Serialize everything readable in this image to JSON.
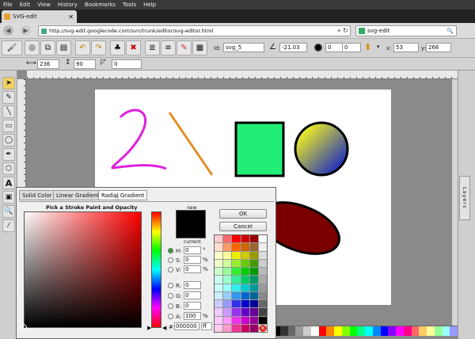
{
  "menubar": {
    "items": [
      "File",
      "Edit",
      "View",
      "History",
      "Bookmarks",
      "Tools",
      "Help"
    ]
  },
  "browser": {
    "tab_title": "SVG-edit",
    "url": "http://svg-edit.googlecode.com/svn/trunk/editor/svg-editor.html",
    "search_engine": "svg-edit"
  },
  "toolbar": {
    "id_label": "id:",
    "id_value": "svg_5",
    "angle_value": "-21.03",
    "stroke_width_value": "0",
    "blur_value": "0",
    "x_label": "x:",
    "x_value": "53",
    "y_label": "y:",
    "y_value": "266",
    "width_value": "236",
    "height_value": "90",
    "skew_value": "0"
  },
  "layers_label": "Layers",
  "dialog": {
    "tabs": [
      "Solid Color",
      "Linear Gradient",
      "Radial Gradient"
    ],
    "active_tab": 2,
    "heading": "Pick a Stroke Paint and Opacity",
    "new_label": "new",
    "current_label": "current",
    "ok_label": "OK",
    "cancel_label": "Cancel",
    "fields": [
      {
        "label": "H:",
        "value": "0",
        "unit": "°"
      },
      {
        "label": "S:",
        "value": "0",
        "unit": "%"
      },
      {
        "label": "V:",
        "value": "0",
        "unit": "%"
      },
      {
        "label": "R:",
        "value": "0",
        "unit": ""
      },
      {
        "label": "G:",
        "value": "0",
        "unit": ""
      },
      {
        "label": "B:",
        "value": "0",
        "unit": ""
      },
      {
        "label": "A:",
        "value": "100",
        "unit": "%"
      }
    ],
    "hex_label": "#:",
    "hex_value": "000000",
    "hex_alpha": "ff",
    "new_color": "#000000",
    "current_color": "#000000"
  },
  "colors": {
    "purple_path": "#dd22dd",
    "orange_line": "#e0902a",
    "green_rect": "#22ee77",
    "ellipse_fill": "#7a0000",
    "gradient_start": "#eeee22",
    "gradient_end": "#2233bb"
  }
}
